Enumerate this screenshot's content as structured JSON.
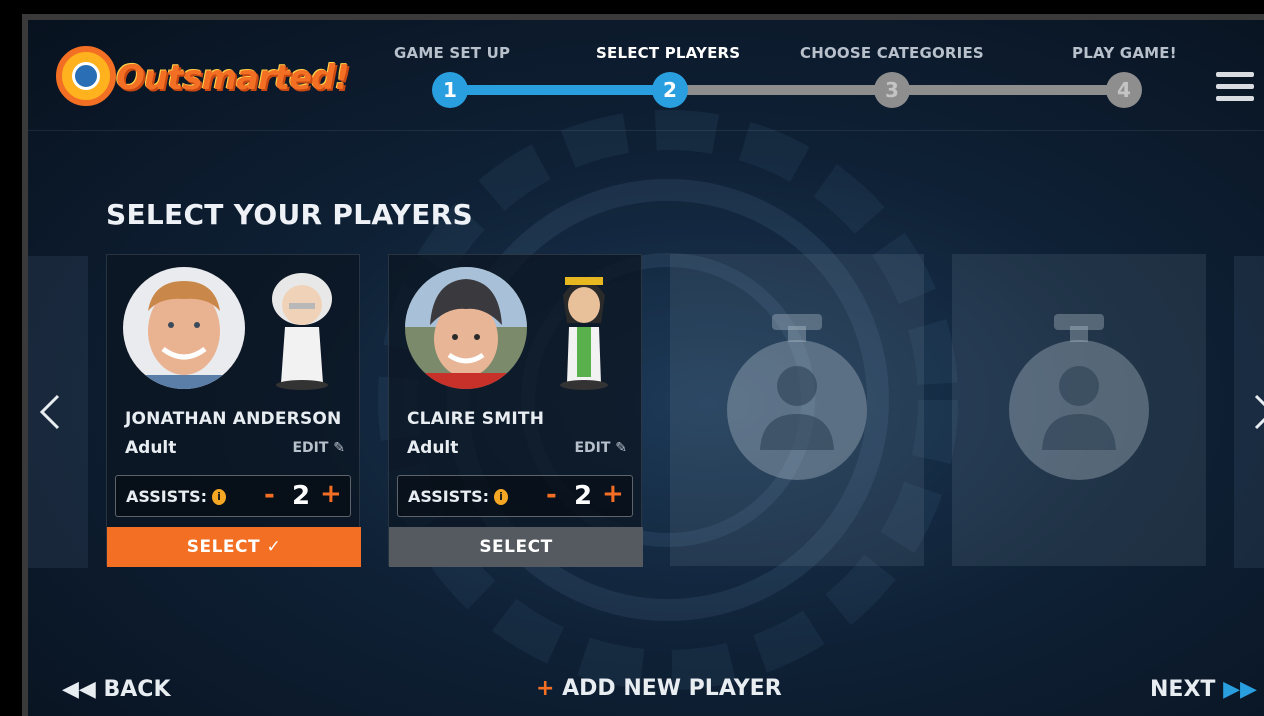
{
  "app": {
    "logo_text": "Outsmarted!"
  },
  "steps": [
    {
      "label": "GAME SET UP",
      "number": "1",
      "state": "done"
    },
    {
      "label": "SELECT PLAYERS",
      "number": "2",
      "state": "active"
    },
    {
      "label": "CHOOSE CATEGORIES",
      "number": "3",
      "state": "pending"
    },
    {
      "label": "PLAY GAME!",
      "number": "4",
      "state": "pending"
    }
  ],
  "page": {
    "title": "SELECT YOUR PLAYERS"
  },
  "players": [
    {
      "name": "JONATHAN ANDERSON",
      "type": "Adult",
      "edit_label": "EDIT",
      "assists_label": "ASSISTS:",
      "assists": "2",
      "select_label": "SELECT ✓",
      "selected": true,
      "avatar": "einstein-figure"
    },
    {
      "name": "CLAIRE SMITH",
      "type": "Adult",
      "edit_label": "EDIT",
      "assists_label": "ASSISTS:",
      "assists": "2",
      "select_label": "SELECT",
      "selected": false,
      "avatar": "cleopatra-figure"
    }
  ],
  "footer": {
    "back_label": "BACK",
    "add_label": "ADD NEW PLAYER",
    "next_label": "NEXT"
  },
  "colors": {
    "accent": "#f36f24",
    "step_active": "#2a9fe0",
    "step_pending": "#8e8e8e",
    "select_inactive": "#555a60"
  },
  "icons": {
    "menu": "hamburger-icon",
    "edit": "pencil-icon",
    "info": "info-icon",
    "prev": "chevron-left-icon",
    "next": "chevron-right-icon",
    "empty_slot": "stopwatch-player-icon"
  }
}
